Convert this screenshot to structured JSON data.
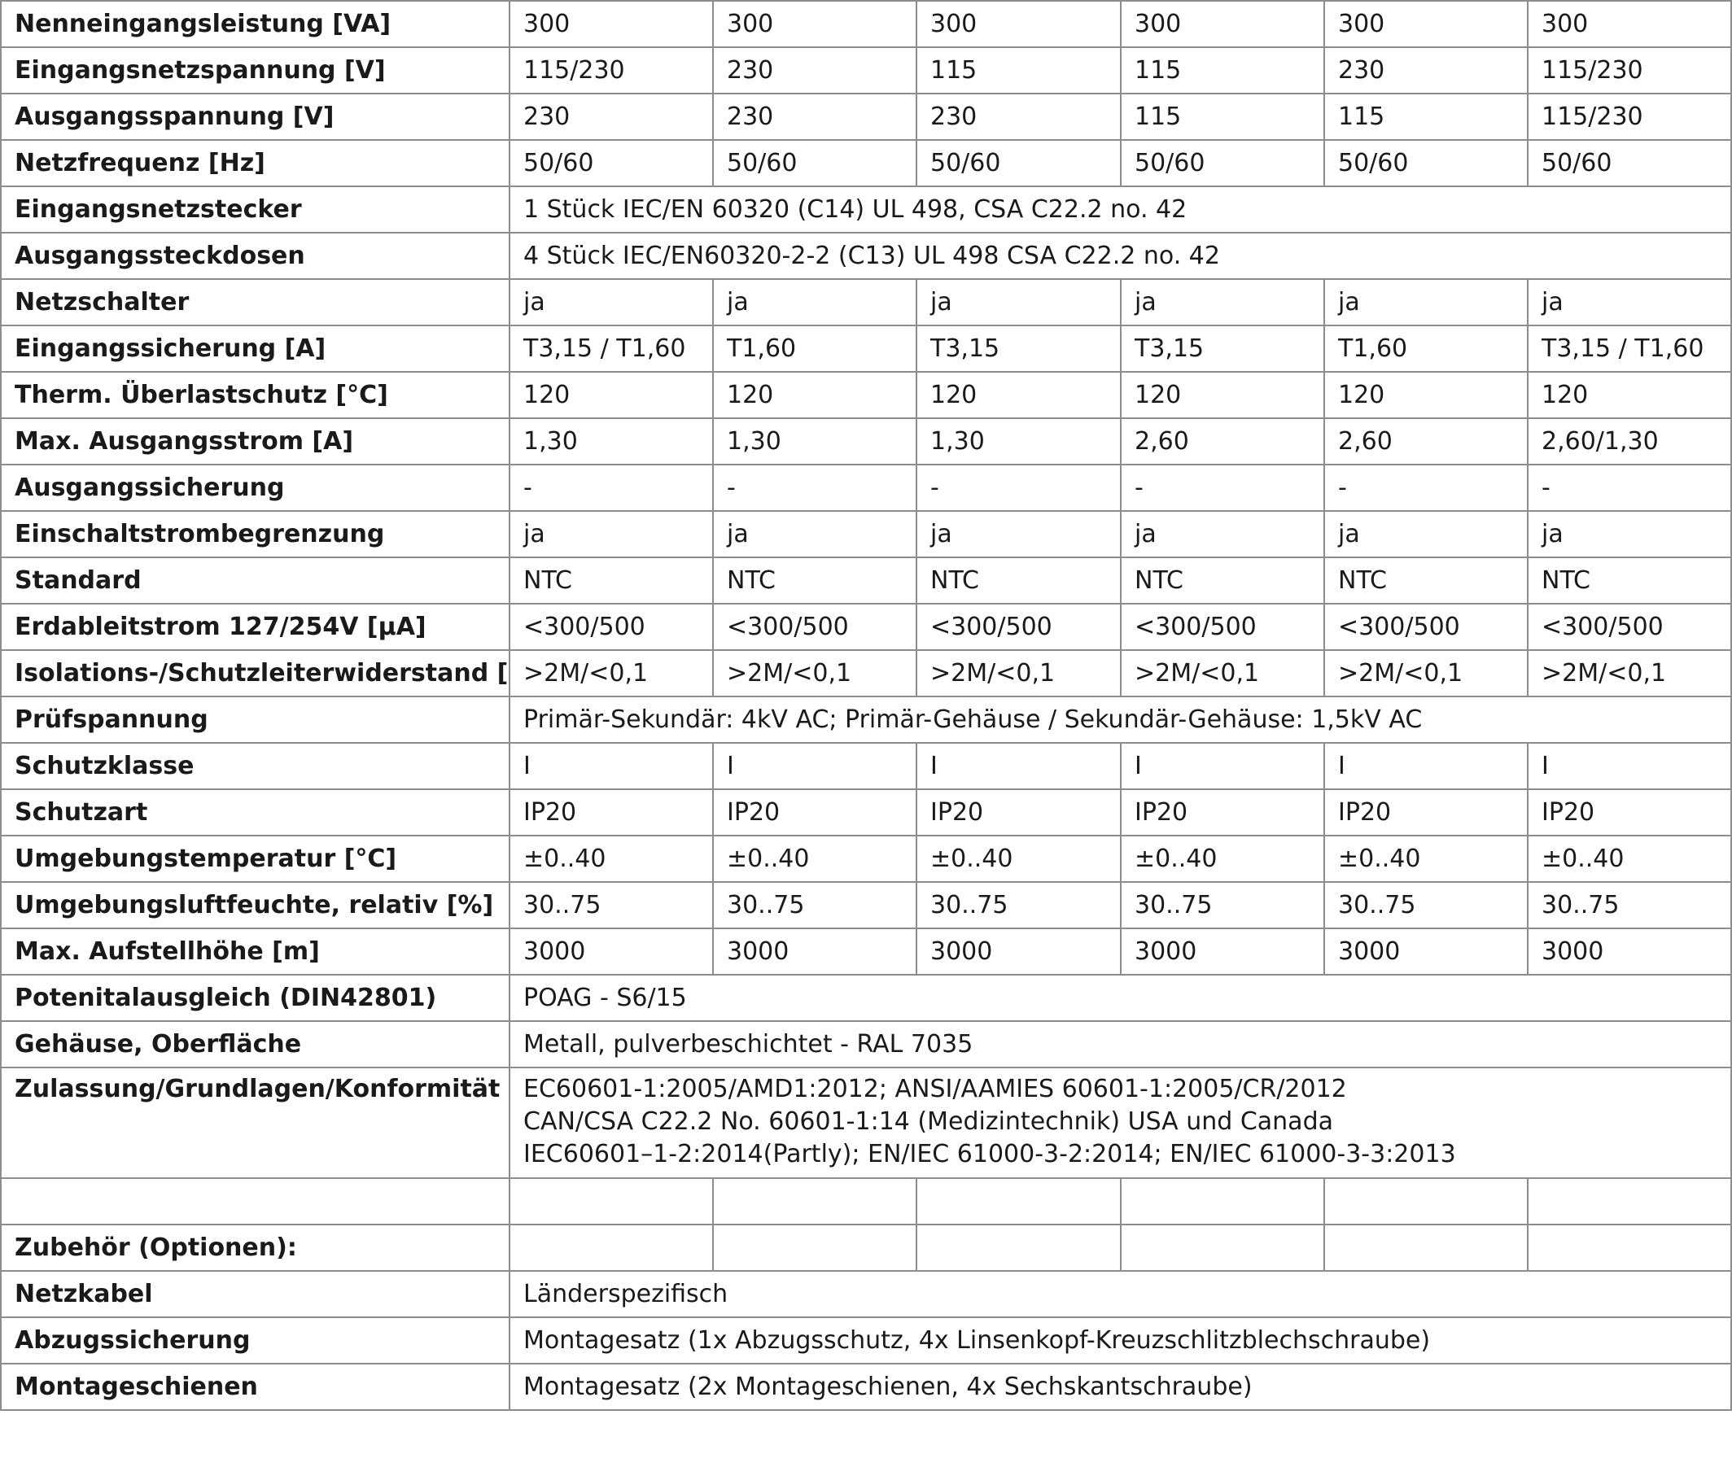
{
  "rows": [
    {
      "type": "values",
      "label": "Nenneingangsleistung [VA]",
      "values": [
        "300",
        "300",
        "300",
        "300",
        "300",
        "300"
      ]
    },
    {
      "type": "values",
      "label": "Eingangsnetzspannung [V]",
      "values": [
        "115/230",
        "230",
        "115",
        "115",
        "230",
        "115/230"
      ]
    },
    {
      "type": "values",
      "label": "Ausgangsspannung [V]",
      "values": [
        "230",
        "230",
        "230",
        "115",
        "115",
        "115/230"
      ]
    },
    {
      "type": "values",
      "label": "Netzfrequenz [Hz]",
      "values": [
        "50/60",
        "50/60",
        "50/60",
        "50/60",
        "50/60",
        "50/60"
      ]
    },
    {
      "type": "span",
      "label": "Eingangsnetzstecker",
      "value": "1 Stück IEC/EN 60320 (C14) UL 498, CSA C22.2 no. 42"
    },
    {
      "type": "span",
      "label": "Ausgangssteckdosen",
      "value": "4 Stück IEC/EN60320-2-2 (C13) UL 498 CSA C22.2 no. 42"
    },
    {
      "type": "values",
      "label": "Netzschalter",
      "values": [
        "ja",
        "ja",
        "ja",
        "ja",
        "ja",
        "ja"
      ]
    },
    {
      "type": "values",
      "label": "Eingangssicherung [A]",
      "values": [
        "T3,15 / T1,60",
        "T1,60",
        "T3,15",
        "T3,15",
        "T1,60",
        "T3,15 / T1,60"
      ]
    },
    {
      "type": "values",
      "label": "Therm. Überlastschutz [°C]",
      "values": [
        "120",
        "120",
        "120",
        "120",
        "120",
        "120"
      ]
    },
    {
      "type": "values",
      "label": "Max. Ausgangsstrom [A]",
      "values": [
        "1,30",
        "1,30",
        "1,30",
        "2,60",
        "2,60",
        "2,60/1,30"
      ]
    },
    {
      "type": "values",
      "label": "Ausgangssicherung",
      "values": [
        "-",
        "-",
        "-",
        "-",
        "-",
        "-"
      ]
    },
    {
      "type": "values",
      "label": "Einschaltstrombegrenzung",
      "values": [
        "ja",
        "ja",
        "ja",
        "ja",
        "ja",
        "ja"
      ]
    },
    {
      "type": "values",
      "label": "Standard",
      "values": [
        "NTC",
        "NTC",
        "NTC",
        "NTC",
        "NTC",
        "NTC"
      ]
    },
    {
      "type": "values",
      "label": "Erdableitstrom 127/254V [µA]",
      "values": [
        "<300/500",
        "<300/500",
        "<300/500",
        "<300/500",
        "<300/500",
        "<300/500"
      ]
    },
    {
      "type": "values",
      "label": "Isolations-/Schutzleiterwiderstand [Ω]",
      "values": [
        ">2M/<0,1",
        ">2M/<0,1",
        ">2M/<0,1",
        ">2M/<0,1",
        ">2M/<0,1",
        ">2M/<0,1"
      ]
    },
    {
      "type": "span",
      "label": "Prüfspannung",
      "value": "Primär-Sekundär: 4kV AC; Primär-Gehäuse / Sekundär-Gehäuse: 1,5kV AC"
    },
    {
      "type": "values",
      "label": "Schutzklasse",
      "values": [
        "I",
        "I",
        "I",
        "I",
        "I",
        "I"
      ]
    },
    {
      "type": "values",
      "label": "Schutzart",
      "values": [
        "IP20",
        "IP20",
        "IP20",
        "IP20",
        "IP20",
        "IP20"
      ]
    },
    {
      "type": "values",
      "label": "Umgebungstemperatur [°C]",
      "values": [
        "±0..40",
        "±0..40",
        "±0..40",
        "±0..40",
        "±0..40",
        "±0..40"
      ]
    },
    {
      "type": "values",
      "label": "Umgebungsluftfeuchte, relativ [%]",
      "values": [
        "30..75",
        "30..75",
        "30..75",
        "30..75",
        "30..75",
        "30..75"
      ]
    },
    {
      "type": "values",
      "label": "Max. Aufstellhöhe [m]",
      "values": [
        "3000",
        "3000",
        "3000",
        "3000",
        "3000",
        "3000"
      ]
    },
    {
      "type": "span",
      "label": "Potenitalausgleich (DIN42801)",
      "value": "POAG - S6/15"
    },
    {
      "type": "span",
      "label": "Gehäuse, Oberfläche",
      "value": "Metall, pulverbeschichtet - RAL 7035"
    },
    {
      "type": "multi",
      "label": "Zulassung/Grundlagen/Konformität CE",
      "lines": [
        "EC60601-1:2005/AMD1:2012; ANSI/AAMIES 60601-1:2005/CR/2012",
        "CAN/CSA C22.2 No. 60601-1:14 (Medizintechnik) USA und Canada",
        "IEC60601–1-2:2014(Partly); EN/IEC 61000-3-2:2014; EN/IEC 61000-3-3:2013"
      ]
    },
    {
      "type": "values",
      "label": "",
      "values": [
        "",
        "",
        "",
        "",
        "",
        ""
      ]
    },
    {
      "type": "values",
      "label": "Zubehör (Optionen):",
      "values": [
        "",
        "",
        "",
        "",
        "",
        ""
      ]
    },
    {
      "type": "span",
      "label": "Netzkabel",
      "value": "Länderspezifisch"
    },
    {
      "type": "span",
      "label": "Abzugssicherung",
      "value": "Montagesatz (1x Abzugsschutz, 4x Linsenkopf-Kreuzschlitzblechschraube)"
    },
    {
      "type": "span",
      "label": "Montageschienen",
      "value": "Montagesatz (2x Montageschienen, 4x Sechskantschraube)"
    }
  ]
}
